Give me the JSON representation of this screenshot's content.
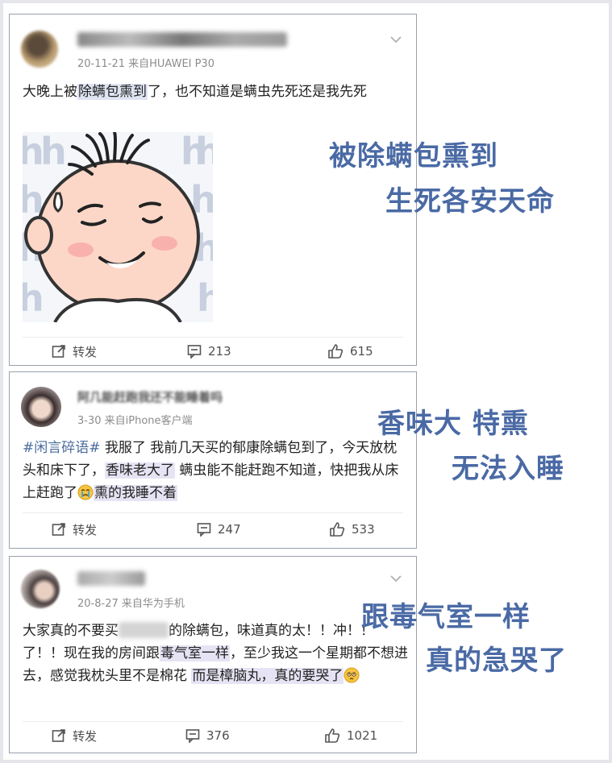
{
  "posts": [
    {
      "meta": "20-11-21  来自HUAWEI P30",
      "body": {
        "pre": "大晚上被",
        "hl": "除螨包熏到",
        "post": "了，也不知道是螨虫先死还是我先死"
      },
      "image_text": "h",
      "actions": {
        "repost": "转发",
        "comments": "213",
        "likes": "615"
      },
      "caption": {
        "line1": "被除螨包熏到",
        "line2": "生死各安天命"
      }
    },
    {
      "name": "阿几能赶跑我还不能睡着吗",
      "meta": "3-30  来自iPhone客户端",
      "body": {
        "tag": "#闲言碎语#",
        "seg1": " 我服了 我前几天买的郁康除螨包到了，今天放枕头和床下了，",
        "hl1": "香味老大了",
        "seg2": " 螨虫能不能赶跑不知道，快把我从床上赶跑了",
        "hl2": "熏的我睡不着"
      },
      "actions": {
        "repost": "转发",
        "comments": "247",
        "likes": "533"
      },
      "caption": {
        "line1": "香味大 特熏",
        "line2": "无法入睡"
      }
    },
    {
      "meta": "20-8-27  来自华为手机",
      "body": {
        "pre": "大家真的不要买",
        "mid": "的除螨包，味道真的太！！冲！！了！！现在我的房间跟",
        "hl1": "毒气室一样",
        "seg2": "，至少我这一个星期都不想进去，感觉我枕头里不是棉花 ",
        "hl2": "而是樟脑丸，真的要哭了"
      },
      "actions": {
        "repost": "转发",
        "comments": "376",
        "likes": "1021"
      },
      "caption": {
        "line1": "跟毒气室一样",
        "line2": "真的急哭了"
      }
    }
  ],
  "icons": {
    "repost": "edit-share-icon",
    "comment": "comment-icon",
    "like": "thumbs-up-icon",
    "more": "chevron-down-icon",
    "emoji_cry": "crying-face-icon",
    "emoji_roll": "pleading-face-icon"
  },
  "colors": {
    "caption": "#4a6aa5",
    "highlight": "#dfe4f3",
    "tag": "#4a6c9c"
  }
}
